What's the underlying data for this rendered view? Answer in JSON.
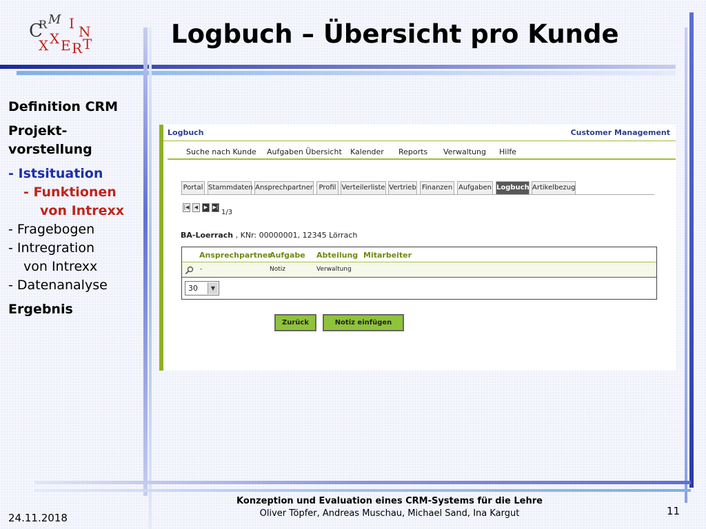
{
  "slide": {
    "title": "Logbuch – Übersicht pro Kunde",
    "logo": {
      "letters": [
        "C",
        "R",
        "M",
        "I",
        "N",
        "X",
        "X",
        "E",
        "R",
        "T"
      ]
    }
  },
  "agenda": {
    "items": [
      "Definition CRM",
      "Projekt-",
      "vorstellung",
      "- Istsituation",
      "- Funktionen",
      "von Intrexx",
      "- Fragebogen",
      "- Intregration",
      "von Intrexx",
      "- Datenanalyse",
      "Ergebnis"
    ]
  },
  "app": {
    "title": "Logbuch",
    "brand": "Customer Management",
    "menu": [
      "Suche nach Kunde",
      "Aufgaben Übersicht",
      "Kalender",
      "Reports",
      "Verwaltung",
      "Hilfe"
    ],
    "tabs": [
      "Portal",
      "Stammdaten",
      "Ansprechpartner",
      "Profil",
      "Verteilerliste",
      "Vertrieb",
      "Finanzen",
      "Aufgaben",
      "Logbuch",
      "Artikelbezug"
    ],
    "active_tab": "Logbuch",
    "pager": {
      "buttons": [
        "|◀",
        "◀",
        "▶",
        "▶|"
      ],
      "count": "1/3"
    },
    "customer": {
      "name": "BA-Loerrach",
      "details": ", KNr: 00000001, 12345 Lörrach"
    },
    "grid": {
      "columns": [
        "Ansprechpartner",
        "Aufgabe",
        "Abteilung",
        "Mitarbeiter"
      ],
      "rows": [
        {
          "ansprechpartner": "-",
          "aufgabe": "Notiz",
          "abteilung": "Verwaltung",
          "mitarbeiter": ""
        }
      ],
      "page_size": "30"
    },
    "buttons": {
      "back": "Zurück",
      "add_note": "Notiz einfügen"
    }
  },
  "footer": {
    "title": "Konzeption und Evaluation eines CRM-Systems für die Lehre",
    "authors": "Oliver Töpfer, Andreas Muschau, Michael Sand, Ina Kargut",
    "date": "24.11.2018",
    "page": "11"
  },
  "colors": {
    "accent_blue": "#1c2fa8",
    "accent_red": "#c0241a",
    "app_green": "#8fb024",
    "button_green": "#8fc33a"
  }
}
